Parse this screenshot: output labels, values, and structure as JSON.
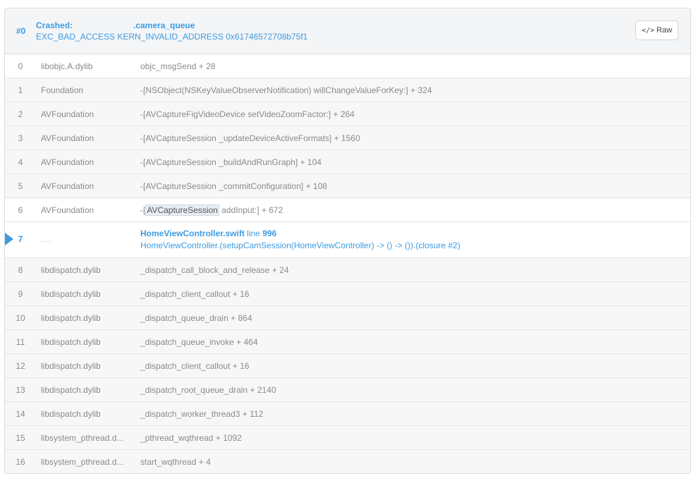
{
  "header": {
    "thread_number": "#0",
    "crashed_label": "Crashed:",
    "queue_name": ".camera_queue",
    "exception": "EXC_BAD_ACCESS KERN_INVALID_ADDRESS 0x61746572708b75f1",
    "raw_button": {
      "icon": "code-icon",
      "label": "Raw"
    }
  },
  "frames": [
    {
      "index": "0",
      "library": "libobjc.A.dylib",
      "symbol": "objc_msgSend",
      "offset": "+ 28"
    },
    {
      "index": "1",
      "library": "Foundation",
      "symbol": "-[NSObject(NSKeyValueObserverNotification) willChangeValueForKey:]",
      "offset": "+ 324"
    },
    {
      "index": "2",
      "library": "AVFoundation",
      "symbol": "-[AVCaptureFigVideoDevice setVideoZoomFactor:]",
      "offset": "+ 264"
    },
    {
      "index": "3",
      "library": "AVFoundation",
      "symbol": "-[AVCaptureSession _updateDeviceActiveFormats]",
      "offset": "+ 1560"
    },
    {
      "index": "4",
      "library": "AVFoundation",
      "symbol": "-[AVCaptureSession _buildAndRunGraph]",
      "offset": "+ 104"
    },
    {
      "index": "5",
      "library": "AVFoundation",
      "symbol": "-[AVCaptureSession _commitConfiguration]",
      "offset": "+ 108"
    },
    {
      "index": "6",
      "library": "AVFoundation",
      "symbol_prefix": "-[",
      "symbol_highlight": "AVCaptureSession",
      "symbol_rest": " addInput:]",
      "offset": "+ 672"
    },
    {
      "index": "7",
      "library": "....",
      "file": "HomeViewController.swift",
      "line_label": "line",
      "line": "996",
      "closure": "HomeViewController.(setupCamSession(HomeViewController) -> () -> ()).(closure #2)"
    },
    {
      "index": "8",
      "library": "libdispatch.dylib",
      "symbol": "_dispatch_call_block_and_release",
      "offset": "+ 24"
    },
    {
      "index": "9",
      "library": "libdispatch.dylib",
      "symbol": "_dispatch_client_callout",
      "offset": "+ 16"
    },
    {
      "index": "10",
      "library": "libdispatch.dylib",
      "symbol": "_dispatch_queue_drain",
      "offset": "+ 864"
    },
    {
      "index": "11",
      "library": "libdispatch.dylib",
      "symbol": "_dispatch_queue_invoke",
      "offset": "+ 464"
    },
    {
      "index": "12",
      "library": "libdispatch.dylib",
      "symbol": "_dispatch_client_callout",
      "offset": "+ 16"
    },
    {
      "index": "13",
      "library": "libdispatch.dylib",
      "symbol": "_dispatch_root_queue_drain",
      "offset": "+ 2140"
    },
    {
      "index": "14",
      "library": "libdispatch.dylib",
      "symbol": "_dispatch_worker_thread3",
      "offset": "+ 112"
    },
    {
      "index": "15",
      "library": "libsystem_pthread.d...",
      "symbol": "_pthread_wqthread",
      "offset": "+ 1092"
    },
    {
      "index": "16",
      "library": "libsystem_pthread.d...",
      "symbol": "start_wqthread",
      "offset": "+ 4"
    }
  ],
  "colors": {
    "accent": "#3d9be0",
    "muted_text": "#8a8a8a",
    "row_bg": "#f7f7f7"
  }
}
